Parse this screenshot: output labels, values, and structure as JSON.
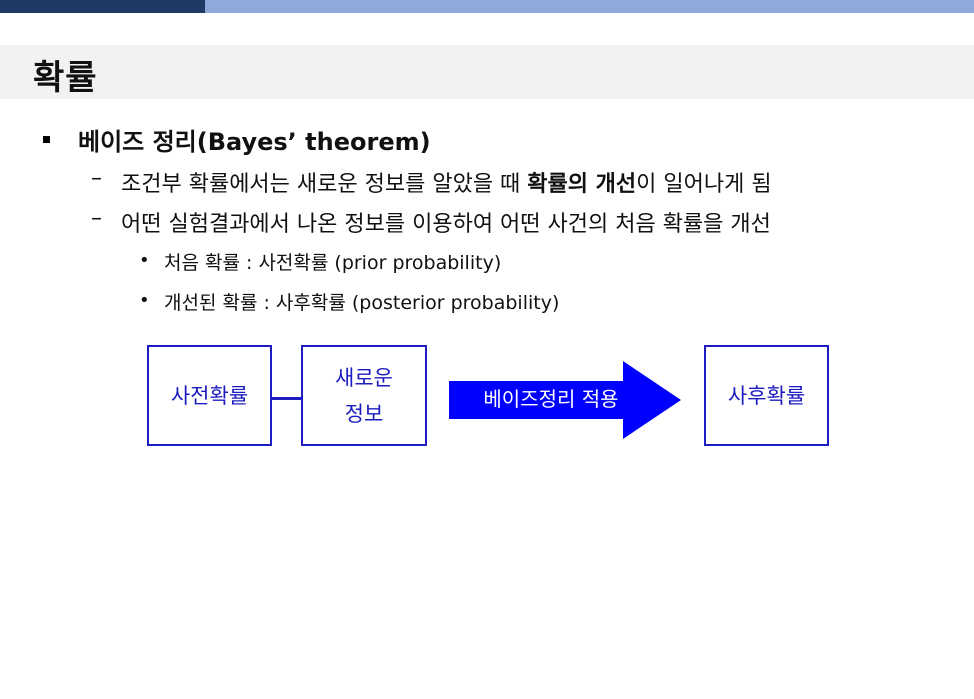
{
  "slide": {
    "title": "확률",
    "bullet": "베이즈 정리(Bayes’ theorem)",
    "sub1": {
      "pre": "조건부 확률에서는 새로운 정보를 알았을 때 ",
      "bold": "확률의 개선",
      "post": "이 일어나게 됨"
    },
    "sub2": "어떤 실험결과에서 나온 정보를 이용하여 어떤 사건의 처음 확률을 개선",
    "sub2_items": [
      "처음 확률 : 사전확률 (prior probability)",
      "개선된 확률 : 사후확률 (posterior probability)"
    ],
    "dash_glyph": "–",
    "dot_glyph": "•"
  },
  "diagram": {
    "box_prior": "사전확률",
    "box_new_info_line1": "새로운",
    "box_new_info_line2": "정보",
    "arrow_label": "베이즈정리 적용",
    "box_posterior": "사후확률",
    "colors": {
      "border": "#1c1cc0",
      "arrow": "#0000ff"
    }
  }
}
